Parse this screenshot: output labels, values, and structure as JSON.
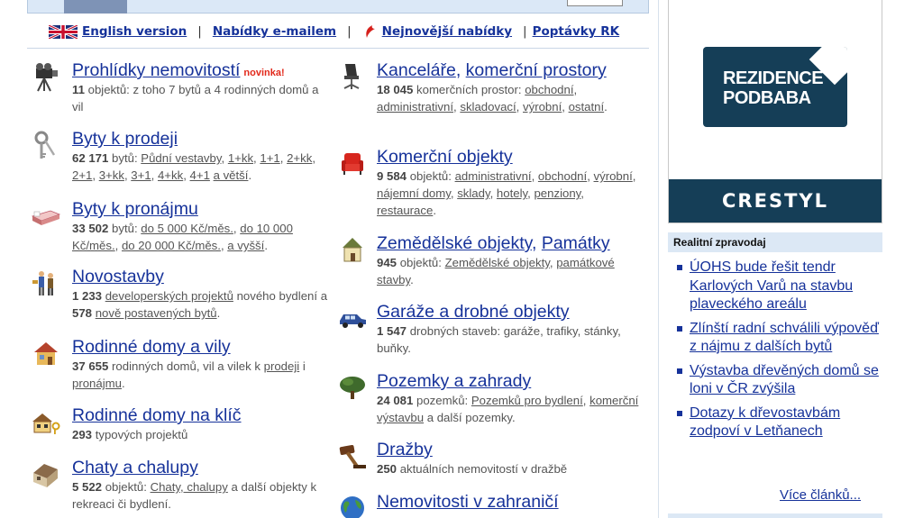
{
  "toplinks": {
    "english": "English version",
    "email": "Nabídky e-mailem",
    "newest": "Nejnovější nabídky",
    "demands": "Poptávky RK",
    "separator": "|"
  },
  "left_items": [
    {
      "title": "Prohlídky nemovitostí",
      "badge": "novinka!",
      "count": "11",
      "desc_parts": [
        "objektů: z toho 7 bytů a 4 rodinných domů a vil"
      ]
    },
    {
      "title": "Byty k prodeji",
      "count": "62 171",
      "text1": "bytů:",
      "links": [
        "Půdní vestavby",
        "1+kk",
        "1+1",
        "2+kk",
        "2+1",
        "3+kk",
        "3+1",
        "4+kk",
        "4+1",
        "a větší"
      ],
      "end": "."
    },
    {
      "title": "Byty k pronájmu",
      "count": "33 502",
      "text1": "bytů:",
      "links": [
        "do 5 000 Kč/měs.",
        "do 10 000 Kč/měs.",
        "do 20 000 Kč/měs.",
        "a vyšší"
      ],
      "end": "."
    },
    {
      "title": "Novostavby",
      "count": "1 233",
      "link1": "developerských projektů",
      "text1": "nového bydlení a",
      "count2": "578",
      "link2": "nově postavených bytů",
      "end": "."
    },
    {
      "title": "Rodinné domy a vily",
      "count": "37 655",
      "text1": "rodinných domů, vil a vilek k",
      "link1": "prodeji",
      "text2": "i",
      "link2": "pronájmu",
      "end": "."
    },
    {
      "title": "Rodinné domy na klíč",
      "count": "293",
      "text1": "typových projektů"
    },
    {
      "title": "Chaty a chalupy",
      "count": "5 522",
      "text1": "objektů:",
      "link1": "Chaty, chalupy",
      "text2": "a další objekty k rekreaci či bydlení."
    }
  ],
  "right_items": [
    {
      "title": "Kanceláře",
      "title2": "komerční prostory",
      "count": "18 045",
      "text1": "komerčních prostor:",
      "links": [
        "obchodní",
        "administrativní",
        "skladovací",
        "výrobní",
        "ostatní"
      ],
      "end": "."
    },
    {
      "title": "Komerční objekty",
      "count": "9 584",
      "text1": "objektů:",
      "links": [
        "administrativní",
        "obchodní",
        "výrobní",
        "nájemní domy",
        "sklady",
        "hotely",
        "penziony",
        "restaurace"
      ],
      "end": "."
    },
    {
      "title": "Zemědělské objekty",
      "title2": "Památky",
      "count": "945",
      "text1": "objektů:",
      "links": [
        "Zemědělské objekty",
        "památkové stavby"
      ],
      "end": "."
    },
    {
      "title": "Garáže a drobné objekty",
      "count": "1 547",
      "text1": "drobných staveb: garáže, trafiky, stánky, buňky."
    },
    {
      "title": "Pozemky a zahrady",
      "count": "24 081",
      "text1": "pozemků:",
      "links": [
        "Pozemků pro bydlení",
        "komerční výstavbu"
      ],
      "text2": "a další pozemky."
    },
    {
      "title": "Dražby",
      "count": "250",
      "text1": "aktuálních nemovitostí v dražbě"
    },
    {
      "title": "Nemovitosti v zahraničí"
    }
  ],
  "ad": {
    "logo_line1": "REZIDENCE",
    "logo_line2": "PODBABA",
    "brand": "CRESTYL"
  },
  "news": {
    "heading": "Realitní zpravodaj",
    "items": [
      "ÚOHS bude řešit tendr Karlových Varů na stavbu plaveckého areálu",
      "Zlínští radní schválili výpověď z nájmu z dalších bytů",
      "Výstavba dřevěných domů se loni v ČR zvýšila",
      "Dotazy k dřevostavbám zodpoví v Letňanech"
    ],
    "more": "Více článků..."
  },
  "colors": {
    "link": "#16329a",
    "badge": "#e2291b",
    "ad_navy": "#153e57",
    "news_header_bg": "#dce8f5"
  }
}
